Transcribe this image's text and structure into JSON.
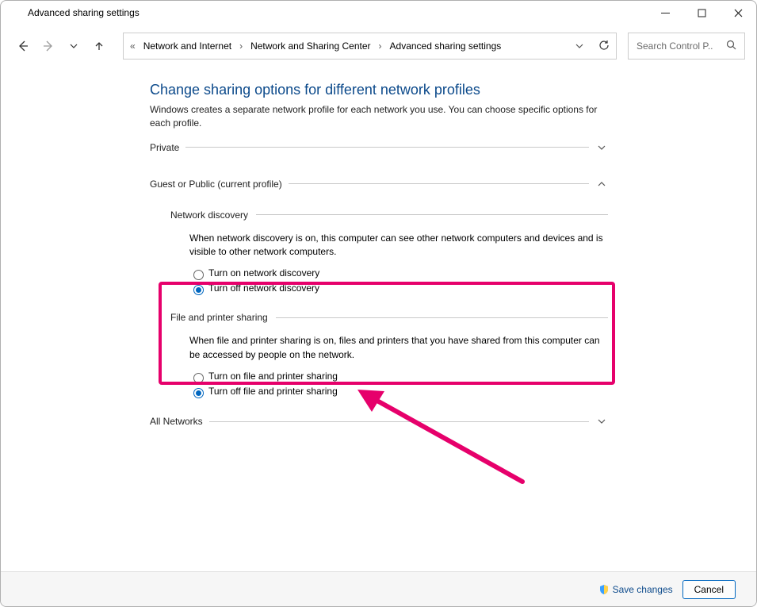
{
  "title": "Advanced sharing settings",
  "breadcrumbs": {
    "item0": "Network and Internet",
    "item1": "Network and Sharing Center",
    "item2": "Advanced sharing settings"
  },
  "search": {
    "placeholder": "Search Control P..."
  },
  "heading": "Change sharing options for different network profiles",
  "subheading": "Windows creates a separate network profile for each network you use. You can choose specific options for each profile.",
  "profiles": {
    "private": {
      "label": "Private"
    },
    "guest": {
      "label": "Guest or Public (current profile)",
      "network_discovery": {
        "title": "Network discovery",
        "desc": "When network discovery is on, this computer can see other network computers and devices and is visible to other network computers.",
        "on": "Turn on network discovery",
        "off": "Turn off network discovery"
      },
      "file_printer": {
        "title": "File and printer sharing",
        "desc": "When file and printer sharing is on, files and printers that you have shared from this computer can be accessed by people on the network.",
        "on": "Turn on file and printer sharing",
        "off": "Turn off file and printer sharing"
      }
    },
    "all": {
      "label": "All Networks"
    }
  },
  "footer": {
    "save": "Save changes",
    "cancel": "Cancel"
  }
}
